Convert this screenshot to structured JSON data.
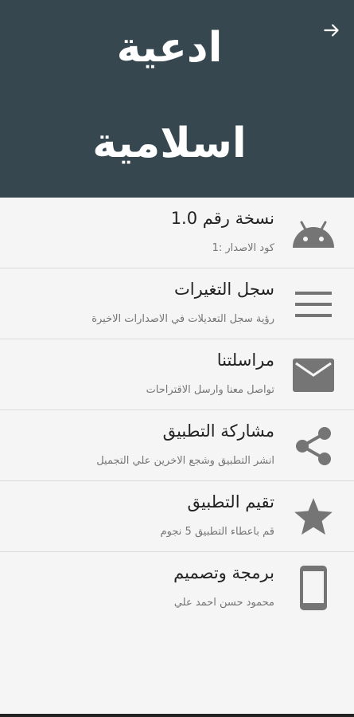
{
  "header": {
    "title": "ادعية اسلامية",
    "background_color": "#37474f",
    "back_icon": "arrow-right-icon"
  },
  "items": [
    {
      "title": "نسخة رقم 1.0",
      "subtitle": "كود الاصدار :1",
      "icon": "android-icon"
    },
    {
      "title": "سجل التغيرات",
      "subtitle": "رؤية سجل التعديلات في الاصدارات الاخيرة",
      "icon": "menu-lines-icon"
    },
    {
      "title": "مراسلتنا",
      "subtitle": "تواصل معنا وارسل الاقتراحات",
      "icon": "mail-icon"
    },
    {
      "title": "مشاركة التطبيق",
      "subtitle": "انشر التطبيق وشجع الاخرين علي التجميل",
      "icon": "share-icon"
    },
    {
      "title": "تقيم التطبيق",
      "subtitle": "قم باعطاء التطبيق 5 نجوم",
      "icon": "star-icon"
    },
    {
      "title": "برمجة وتصميم",
      "subtitle": "محمود حسن احمد علي",
      "icon": "phone-icon"
    }
  ],
  "colors": {
    "icon_gray": "#757575",
    "text_primary": "#222222",
    "text_secondary": "#757575"
  }
}
